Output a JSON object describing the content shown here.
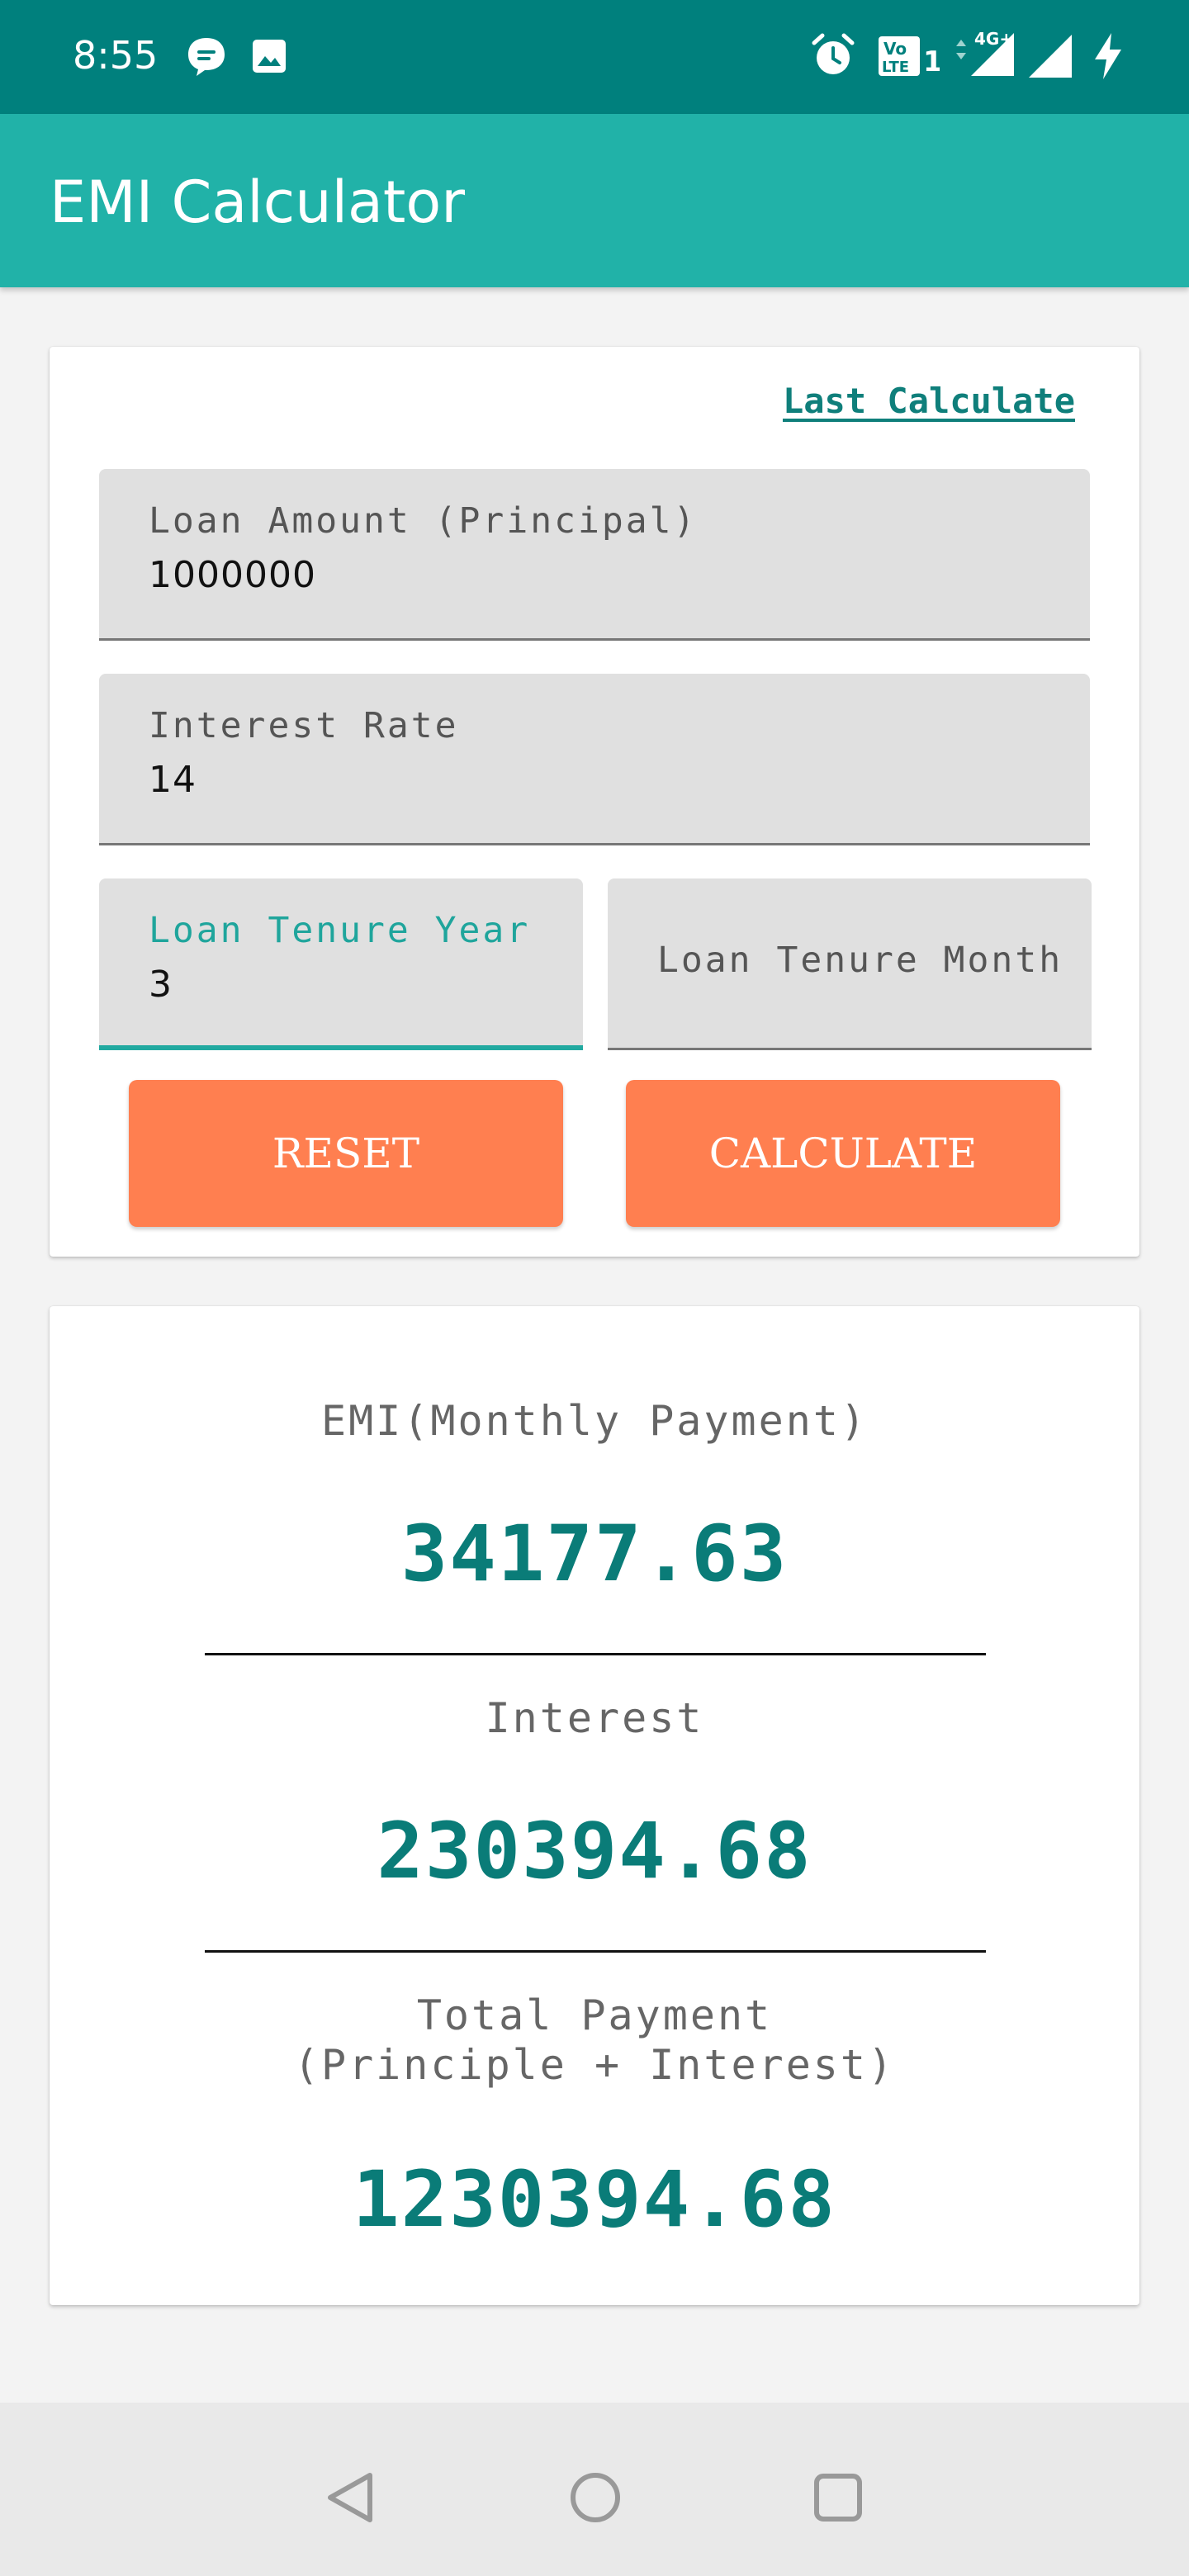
{
  "status_bar": {
    "time": "8:55",
    "left_icons": [
      "chat-bubble-icon",
      "image-icon"
    ],
    "right_icons": [
      "alarm-icon",
      "volte-icon",
      "signal-4g-icon",
      "signal-icon",
      "battery-charging-icon"
    ],
    "volte_label": "Vo LTE 1",
    "network_label": "4G+"
  },
  "app_bar": {
    "title": "EMI Calculator",
    "color": "#21b2a8"
  },
  "form": {
    "last_calculate": "Last Calculate",
    "loan_amount": {
      "label": "Loan Amount (Principal)",
      "value": "1000000"
    },
    "interest_rate": {
      "label": "Interest Rate",
      "value": "14"
    },
    "tenure_year": {
      "label": "Loan Tenure Year",
      "value": "3"
    },
    "tenure_month": {
      "label": "Loan Tenure Month",
      "value": ""
    },
    "reset_label": "RESET",
    "calculate_label": "CALCULATE",
    "button_color": "#ff7f50"
  },
  "results": {
    "emi": {
      "label": "EMI(Monthly Payment)",
      "value": "34177.63"
    },
    "interest": {
      "label": "Interest",
      "value": "230394.68"
    },
    "total": {
      "label_line1": "Total Payment",
      "label_line2": "(Principle + Interest)",
      "value": "1230394.68"
    },
    "value_color": "#0a7c78"
  },
  "nav_bar": {
    "buttons": [
      "back-icon",
      "home-icon",
      "recents-icon"
    ]
  }
}
